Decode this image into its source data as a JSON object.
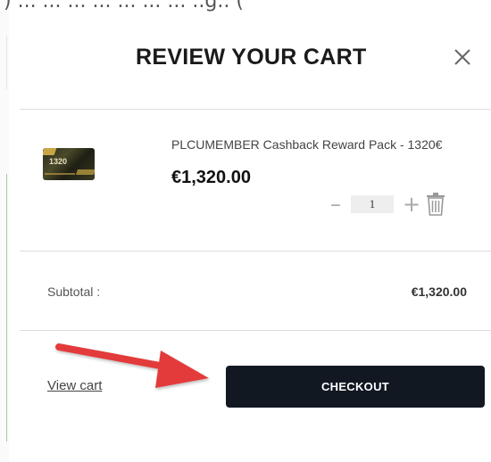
{
  "header_fragment": ") ... ... ... ... ... ... ... ..g.. (",
  "cart": {
    "title": "REVIEW YOUR CART",
    "close_icon": "close-icon"
  },
  "item": {
    "thumbnail_label": "1320",
    "name": "PLCUMEMBER Cashback Reward Pack - 1320€",
    "price": "€1,320.00",
    "quantity": "1",
    "minus_label": "–",
    "plus_label": "+",
    "remove_icon": "trash-icon"
  },
  "summary": {
    "subtotal_label": "Subtotal :",
    "subtotal_value": "€1,320.00"
  },
  "actions": {
    "view_cart_label": "View cart",
    "checkout_label": "CHECKOUT"
  },
  "colors": {
    "checkout_bg": "#111822",
    "arrow": "#e33b3b",
    "divider": "#dcdcdc"
  }
}
